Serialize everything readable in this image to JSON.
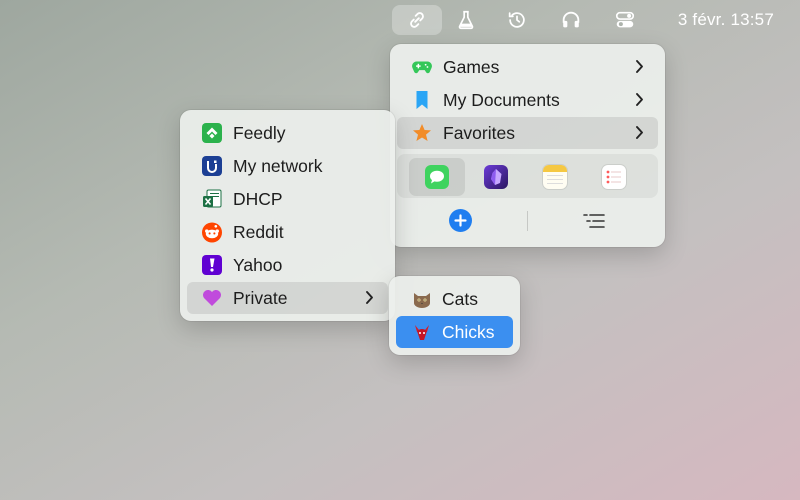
{
  "menubar": {
    "clock": "3 févr. 13:57",
    "icons": [
      "link-icon",
      "flask-icon",
      "history-icon",
      "headphones-icon",
      "control-center-icon"
    ]
  },
  "main_menu": {
    "items": [
      {
        "label": "Games",
        "icon": "gamepad-icon"
      },
      {
        "label": "My Documents",
        "icon": "bookmark-icon"
      },
      {
        "label": "Favorites",
        "icon": "star-icon",
        "highlighted": true
      }
    ],
    "apps": [
      "messages-icon",
      "obsidian-icon",
      "notes-icon",
      "reminders-icon"
    ],
    "footer": [
      "add-icon",
      "list-icon"
    ]
  },
  "favorites_menu": {
    "items": [
      {
        "label": "Feedly",
        "icon": "feedly-icon"
      },
      {
        "label": "My network",
        "icon": "unifi-icon"
      },
      {
        "label": "DHCP",
        "icon": "excel-icon"
      },
      {
        "label": "Reddit",
        "icon": "reddit-icon"
      },
      {
        "label": "Yahoo",
        "icon": "yahoo-icon"
      },
      {
        "label": "Private",
        "icon": "heart-icon",
        "highlighted": true
      }
    ]
  },
  "private_menu": {
    "items": [
      {
        "label": "Cats",
        "icon": "cat-icon"
      },
      {
        "label": "Chicks",
        "icon": "chick-icon",
        "selected": true
      }
    ]
  },
  "colors": {
    "accent": "#3b8ff0",
    "games_green": "#34c759",
    "bookmark_blue": "#2aa5f5",
    "star_orange": "#f28c28",
    "feedly_green": "#2bb24c",
    "reddit_orange": "#ff4500",
    "yahoo_purple": "#6001d2",
    "heart_purple": "#c04bdc"
  }
}
